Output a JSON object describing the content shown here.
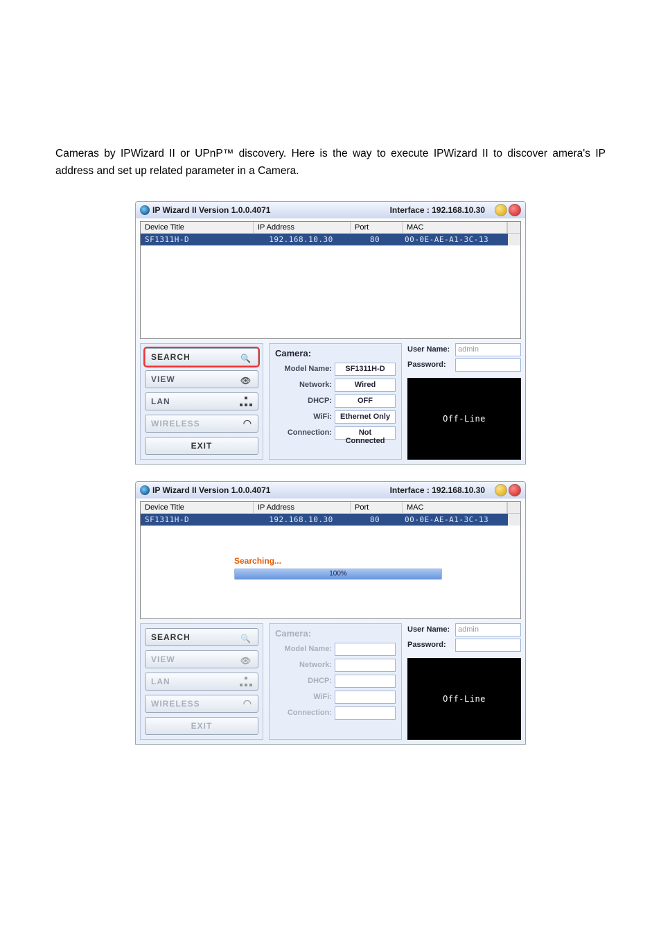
{
  "page_text": "Cameras by IPWizard II or UPnP™ discovery. Here is the way to execute IPWizard II to discover amera's IP address and set up related parameter in a Camera.",
  "window": {
    "title": "IP Wizard II  Version 1.0.0.4071",
    "interface_label": "Interface : 192.168.10.30"
  },
  "grid": {
    "headers": [
      "Device Title",
      "IP Address",
      "Port",
      "MAC"
    ],
    "row": {
      "device_title": "SF1311H-D",
      "ip": "192.168.10.30",
      "port": "80",
      "mac": "00-0E-AE-A1-3C-13"
    }
  },
  "sidebar": {
    "search": "SEARCH",
    "view": "VIEW",
    "lan": "LAN",
    "wireless": "WIRELESS",
    "exit": "EXIT"
  },
  "camera": {
    "section": "Camera:",
    "model_name_label": "Model Name:",
    "model_name": "SF1311H-D",
    "network_label": "Network:",
    "network": "Wired",
    "dhcp_label": "DHCP:",
    "dhcp": "OFF",
    "wifi_label": "WiFi:",
    "wifi": "Ethernet Only",
    "connection_label": "Connection:",
    "connection": "Not Connected"
  },
  "credentials": {
    "user_label": "User Name:",
    "user_value": "admin",
    "pass_label": "Password:",
    "pass_value": ""
  },
  "preview_status": "Off-Line",
  "searching": {
    "label": "Searching...",
    "percent": "100%"
  }
}
